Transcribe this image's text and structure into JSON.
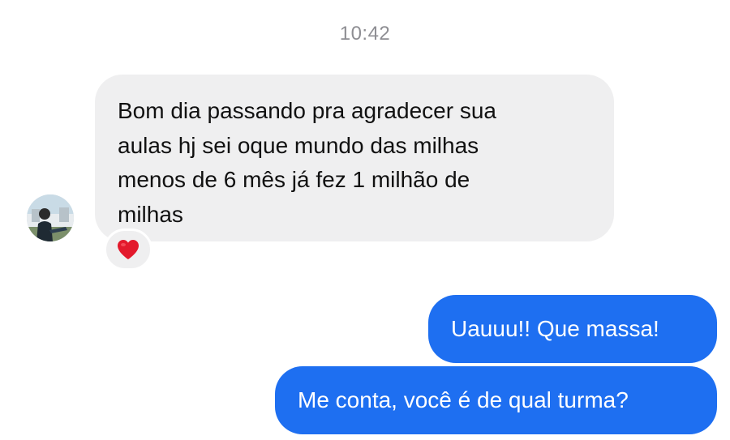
{
  "timestamp": "10:42",
  "incoming": {
    "text": "Bom dia passando  pra agradecer  sua\naulas hj sei oque mundo das milhas\nmenos de 6 mês  já fez 1 milhão  de\nmilhas",
    "reaction": "heart-icon"
  },
  "outgoing": [
    {
      "text": "Uauuu!! Que massa!"
    },
    {
      "text": "Me conta, você é de qual turma?"
    }
  ],
  "colors": {
    "incoming_bubble": "#efeff0",
    "outgoing_bubble": "#1e6ff1",
    "timestamp": "#8e8e93",
    "reaction_heart": "#e3192c"
  }
}
